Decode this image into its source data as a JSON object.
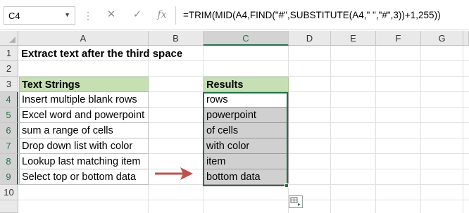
{
  "name_box": {
    "value": "C4"
  },
  "formula_bar": {
    "cancel_icon": "cancel-x-icon",
    "enter_icon": "enter-check-icon",
    "function_icon": "fx-icon",
    "fx_label": "fx",
    "formula": "=TRIM(MID(A4,FIND(\"#\",SUBSTITUTE(A4,\" \",\"#\",3))+1,255))"
  },
  "columns": [
    "A",
    "B",
    "C",
    "D",
    "E",
    "F",
    "G"
  ],
  "rows": [
    "1",
    "2",
    "3",
    "4",
    "5",
    "6",
    "7",
    "8",
    "9",
    "10"
  ],
  "sheet": {
    "title": "Extract text after the third space",
    "text_header": "Text Strings",
    "results_header": "Results",
    "text_strings": [
      "Insert multiple blank rows",
      "Excel word and powerpoint",
      "sum a range of cells",
      "Drop down list with color",
      "Lookup last matching item",
      "Select top or bottom data"
    ],
    "results": [
      "rows",
      "powerpoint",
      "of cells",
      "with color",
      "item",
      "bottom data"
    ]
  },
  "colors": {
    "header_fill": "#c6e0b4",
    "selection_green": "#217346",
    "arrow": "#c0504d",
    "selected_fill": "#d0d0d0"
  }
}
